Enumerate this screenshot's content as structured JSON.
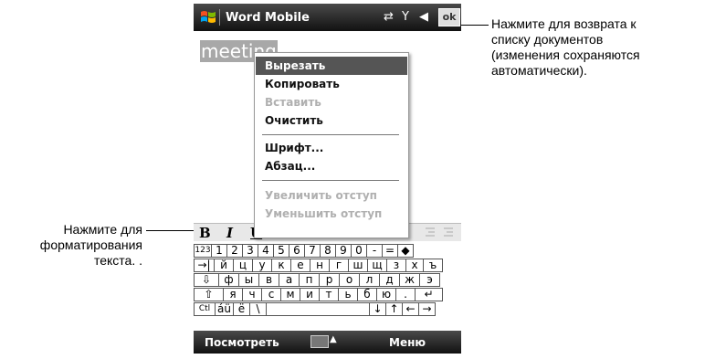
{
  "app": {
    "title": "Word Mobile",
    "ok_label": "ok"
  },
  "status_icons": {
    "sync": "⇄",
    "signal": "Y",
    "volume": "◀"
  },
  "document": {
    "selected_text": "meeting"
  },
  "context_menu": {
    "items": [
      {
        "label": "Вырезать",
        "state": "selected"
      },
      {
        "label": "Копировать",
        "state": "enabled"
      },
      {
        "label": "Вставить",
        "state": "disabled"
      },
      {
        "label": "Очистить",
        "state": "enabled"
      },
      {
        "label": "Шрифт...",
        "state": "enabled"
      },
      {
        "label": "Абзац...",
        "state": "enabled"
      },
      {
        "label": "Увеличить отступ",
        "state": "disabled"
      },
      {
        "label": "Уменьшить отступ",
        "state": "disabled"
      }
    ]
  },
  "format_toolbar": {
    "bold": "B",
    "italic": "I",
    "underline": "U"
  },
  "keyboard": {
    "row1": [
      "123",
      "1",
      "2",
      "3",
      "4",
      "5",
      "6",
      "7",
      "8",
      "9",
      "0",
      "-",
      "=",
      "◆"
    ],
    "row2": [
      "→|",
      "й",
      "ц",
      "у",
      "к",
      "е",
      "н",
      "г",
      "ш",
      "щ",
      "з",
      "х",
      "ъ"
    ],
    "row3": [
      "⇩",
      "ф",
      "ы",
      "в",
      "а",
      "п",
      "р",
      "о",
      "л",
      "д",
      "ж",
      "э"
    ],
    "row4": [
      "⇧",
      "я",
      "ч",
      "с",
      "м",
      "и",
      "т",
      "ь",
      "б",
      "ю",
      ".",
      "↵"
    ],
    "row5": [
      "Ctl",
      "áü",
      "ё",
      "\\",
      "",
      "↓",
      "↑",
      "←",
      "→"
    ]
  },
  "softkeys": {
    "left": "Посмотреть",
    "right": "Меню",
    "sip_arrow": "▲"
  },
  "callouts": {
    "ok_note": [
      "Нажмите для возврата к",
      "списку документов",
      "(изменения сохраняются",
      "автоматически)."
    ],
    "format_note": [
      "Нажмите для",
      "форматирования",
      "текста. ."
    ]
  }
}
